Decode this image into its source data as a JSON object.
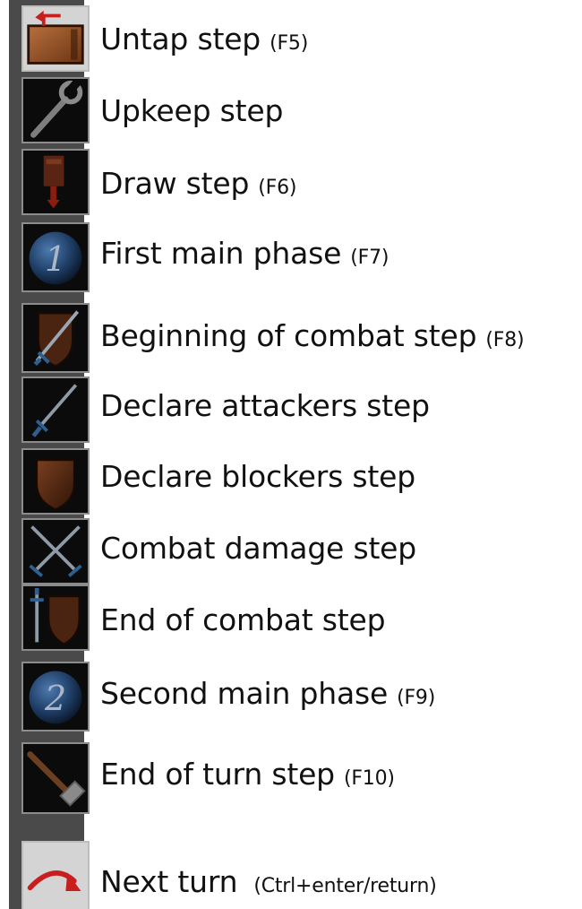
{
  "phases": [
    {
      "label": "Untap step",
      "shortcut": "(F5)",
      "icon": "untap-icon"
    },
    {
      "label": "Upkeep step",
      "shortcut": "",
      "icon": "wrench-icon"
    },
    {
      "label": "Draw step",
      "shortcut": "(F6)",
      "icon": "draw-card-icon"
    },
    {
      "label": "First main phase",
      "shortcut": "(F7)",
      "icon": "number-one-orb-icon"
    },
    {
      "label": "Beginning of combat step",
      "shortcut": "(F8)",
      "icon": "shield-sword-icon"
    },
    {
      "label": "Declare attackers step",
      "shortcut": "",
      "icon": "sword-icon"
    },
    {
      "label": "Declare blockers step",
      "shortcut": "",
      "icon": "shield-icon"
    },
    {
      "label": "Combat damage step",
      "shortcut": "",
      "icon": "crossed-swords-icon"
    },
    {
      "label": "End of combat step",
      "shortcut": "",
      "icon": "sword-and-shield-icon"
    },
    {
      "label": "Second main phase",
      "shortcut": "(F9)",
      "icon": "number-two-orb-icon"
    },
    {
      "label": "End of turn step",
      "shortcut": "(F10)",
      "icon": "hammer-icon"
    }
  ],
  "next_turn": {
    "label": "Next turn",
    "shortcut": "(Ctrl+enter/return)",
    "icon": "curved-arrow-icon"
  },
  "orb_numbers": {
    "first": "1",
    "second": "2"
  },
  "colors": {
    "strip": "#4a4a4a",
    "button": "#0b0b0b",
    "button_border": "#8c8c8c",
    "light_button": "#d4d4d4",
    "brown": "#7a3f20",
    "blue": "#2f5f8f",
    "red": "#c81e1e"
  }
}
